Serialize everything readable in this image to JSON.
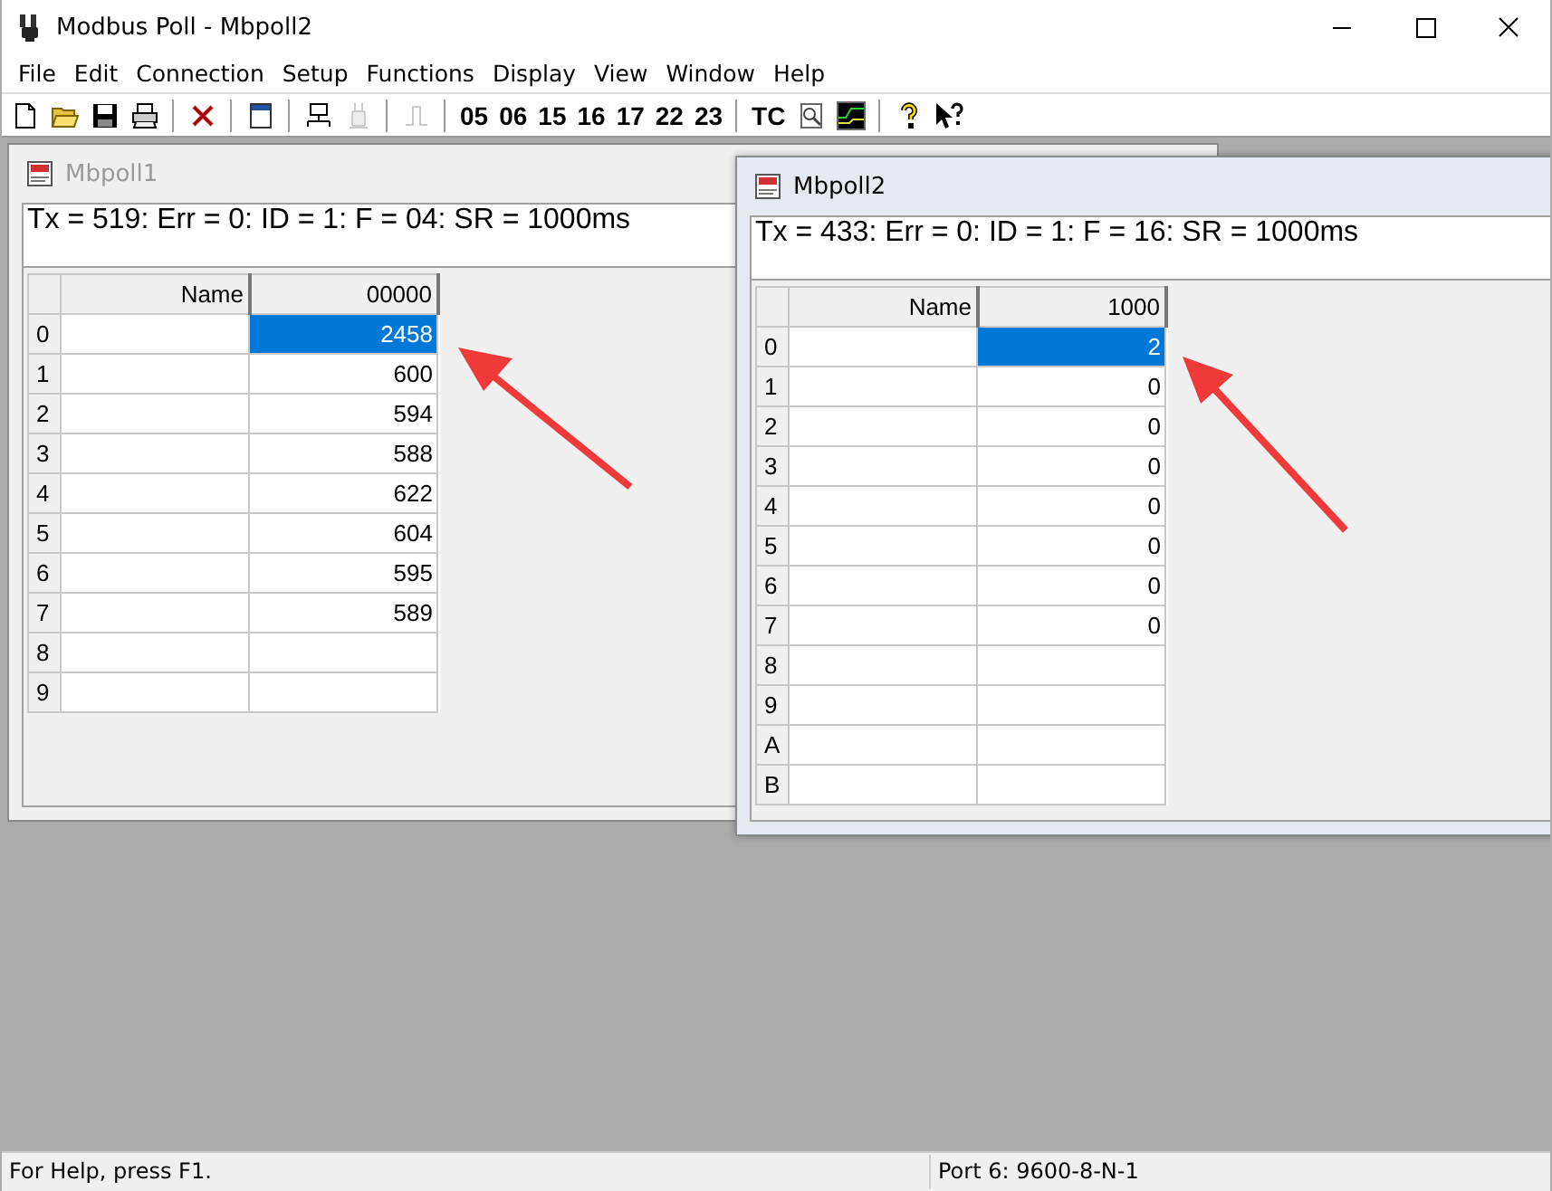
{
  "app": {
    "title": "Modbus Poll - Mbpoll2"
  },
  "menu": [
    {
      "label": "File"
    },
    {
      "label": "Edit"
    },
    {
      "label": "Connection"
    },
    {
      "label": "Setup"
    },
    {
      "label": "Functions"
    },
    {
      "label": "Display"
    },
    {
      "label": "View"
    },
    {
      "label": "Window"
    },
    {
      "label": "Help"
    }
  ],
  "toolbar": [
    {
      "kind": "icon",
      "disabled": false
    },
    {
      "kind": "icon",
      "disabled": false
    },
    {
      "kind": "icon",
      "disabled": false
    },
    {
      "kind": "icon",
      "disabled": false
    },
    {
      "kind": "separator"
    },
    {
      "kind": "icon",
      "disabled": false
    },
    {
      "kind": "separator"
    },
    {
      "kind": "icon",
      "disabled": false
    },
    {
      "kind": "separator"
    },
    {
      "kind": "icon",
      "disabled": false
    },
    {
      "kind": "icon",
      "disabled": true
    },
    {
      "kind": "separator"
    },
    {
      "kind": "icon",
      "disabled": true
    },
    {
      "kind": "separator"
    },
    {
      "kind": "text",
      "label": "05"
    },
    {
      "kind": "text",
      "label": "06"
    },
    {
      "kind": "text",
      "label": "15"
    },
    {
      "kind": "text",
      "label": "16"
    },
    {
      "kind": "text",
      "label": "17"
    },
    {
      "kind": "text",
      "label": "22"
    },
    {
      "kind": "text",
      "label": "23"
    },
    {
      "kind": "separator"
    },
    {
      "kind": "text",
      "label": "TC"
    },
    {
      "kind": "icon",
      "disabled": false
    },
    {
      "kind": "icon",
      "disabled": false
    },
    {
      "kind": "separator"
    },
    {
      "kind": "icon",
      "disabled": false
    },
    {
      "kind": "icon",
      "disabled": false
    }
  ],
  "windows": [
    {
      "title": "Mbpoll1",
      "active": false,
      "info": "Tx = 519: Err = 0: ID = 1: F = 04: SR = 1000ms",
      "columns": [
        "Name",
        "00000"
      ],
      "rows": [
        {
          "header": "0",
          "value": "2458",
          "selected": true
        },
        {
          "header": "1",
          "value": "600",
          "selected": false
        },
        {
          "header": "2",
          "value": "594",
          "selected": false
        },
        {
          "header": "3",
          "value": "588",
          "selected": false
        },
        {
          "header": "4",
          "value": "622",
          "selected": false
        },
        {
          "header": "5",
          "value": "604",
          "selected": false
        },
        {
          "header": "6",
          "value": "595",
          "selected": false
        },
        {
          "header": "7",
          "value": "589",
          "selected": false
        },
        {
          "header": "8",
          "selected": false
        },
        {
          "header": "9",
          "selected": false
        }
      ]
    },
    {
      "title": "Mbpoll2",
      "active": true,
      "info": "Tx = 433: Err = 0: ID = 1: F = 16: SR = 1000ms",
      "columns": [
        "Name",
        "1000"
      ],
      "rows": [
        {
          "header": "0",
          "value": "2",
          "selected": true
        },
        {
          "header": "1",
          "value": "0",
          "selected": false
        },
        {
          "header": "2",
          "value": "0",
          "selected": false
        },
        {
          "header": "3",
          "value": "0",
          "selected": false
        },
        {
          "header": "4",
          "value": "0",
          "selected": false
        },
        {
          "header": "5",
          "value": "0",
          "selected": false
        },
        {
          "header": "6",
          "value": "0",
          "selected": false
        },
        {
          "header": "7",
          "value": "0",
          "selected": false
        },
        {
          "header": "8",
          "selected": false
        },
        {
          "header": "9",
          "selected": false
        },
        {
          "header": "A",
          "selected": false
        },
        {
          "header": "B",
          "selected": false
        }
      ]
    }
  ],
  "status_bar": [
    "For Help, press F1.",
    "Port 6: 9600-8-N-1"
  ]
}
